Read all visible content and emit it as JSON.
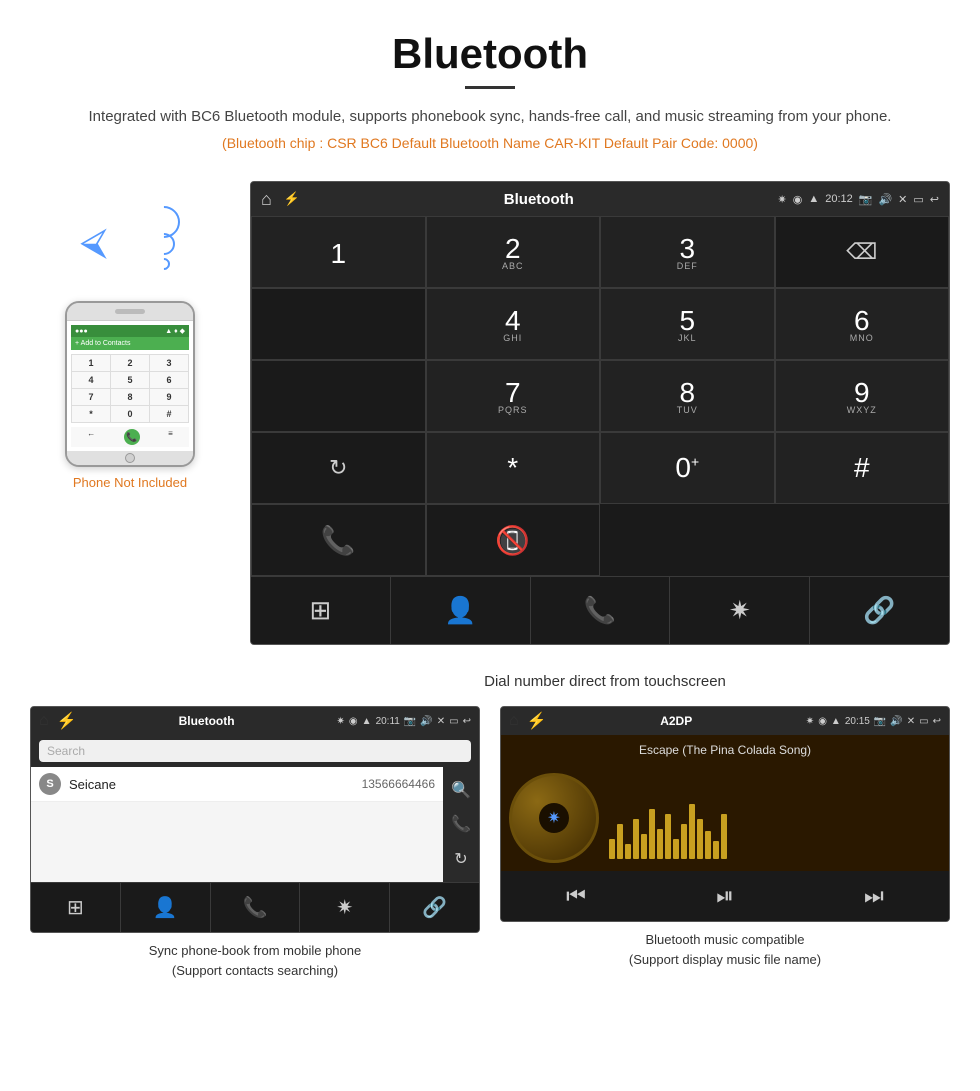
{
  "page": {
    "title": "Bluetooth",
    "divider": true,
    "description": "Integrated with BC6 Bluetooth module, supports phonebook sync, hands-free call, and music streaming from your phone.",
    "specs": "(Bluetooth chip : CSR BC6    Default Bluetooth Name CAR-KIT    Default Pair Code: 0000)"
  },
  "large_screen": {
    "status_bar": {
      "app_name": "Bluetooth",
      "time": "20:12"
    },
    "caption": "Dial number direct from touchscreen"
  },
  "dialpad": {
    "keys": [
      {
        "main": "1",
        "sub": ""
      },
      {
        "main": "2",
        "sub": "ABC"
      },
      {
        "main": "3",
        "sub": "DEF"
      },
      {
        "main": "4",
        "sub": "GHI"
      },
      {
        "main": "5",
        "sub": "JKL"
      },
      {
        "main": "6",
        "sub": "MNO"
      },
      {
        "main": "7",
        "sub": "PQRS"
      },
      {
        "main": "8",
        "sub": "TUV"
      },
      {
        "main": "9",
        "sub": "WXYZ"
      },
      {
        "main": "*",
        "sub": ""
      },
      {
        "main": "0",
        "sub": "+"
      },
      {
        "main": "#",
        "sub": ""
      }
    ]
  },
  "phone_mockup": {
    "status": "●●●",
    "add_contact": "+ Add to Contacts",
    "keys": [
      "1",
      "2",
      "3",
      "4",
      "5",
      "6",
      "7",
      "8",
      "9",
      "*",
      "0",
      "#"
    ],
    "not_included": "Phone Not Included"
  },
  "left_bottom": {
    "status_bar": {
      "app_name": "Bluetooth",
      "time": "20:11"
    },
    "search_placeholder": "Search",
    "contacts": [
      {
        "letter": "S",
        "name": "Seicane",
        "number": "13566664466"
      }
    ],
    "caption_line1": "Sync phone-book from mobile phone",
    "caption_line2": "(Support contacts searching)"
  },
  "right_bottom": {
    "status_bar": {
      "app_name": "A2DP",
      "time": "20:15"
    },
    "song_name": "Escape (The Pina Colada Song)",
    "caption_line1": "Bluetooth music compatible",
    "caption_line2": "(Support display music file name)"
  }
}
